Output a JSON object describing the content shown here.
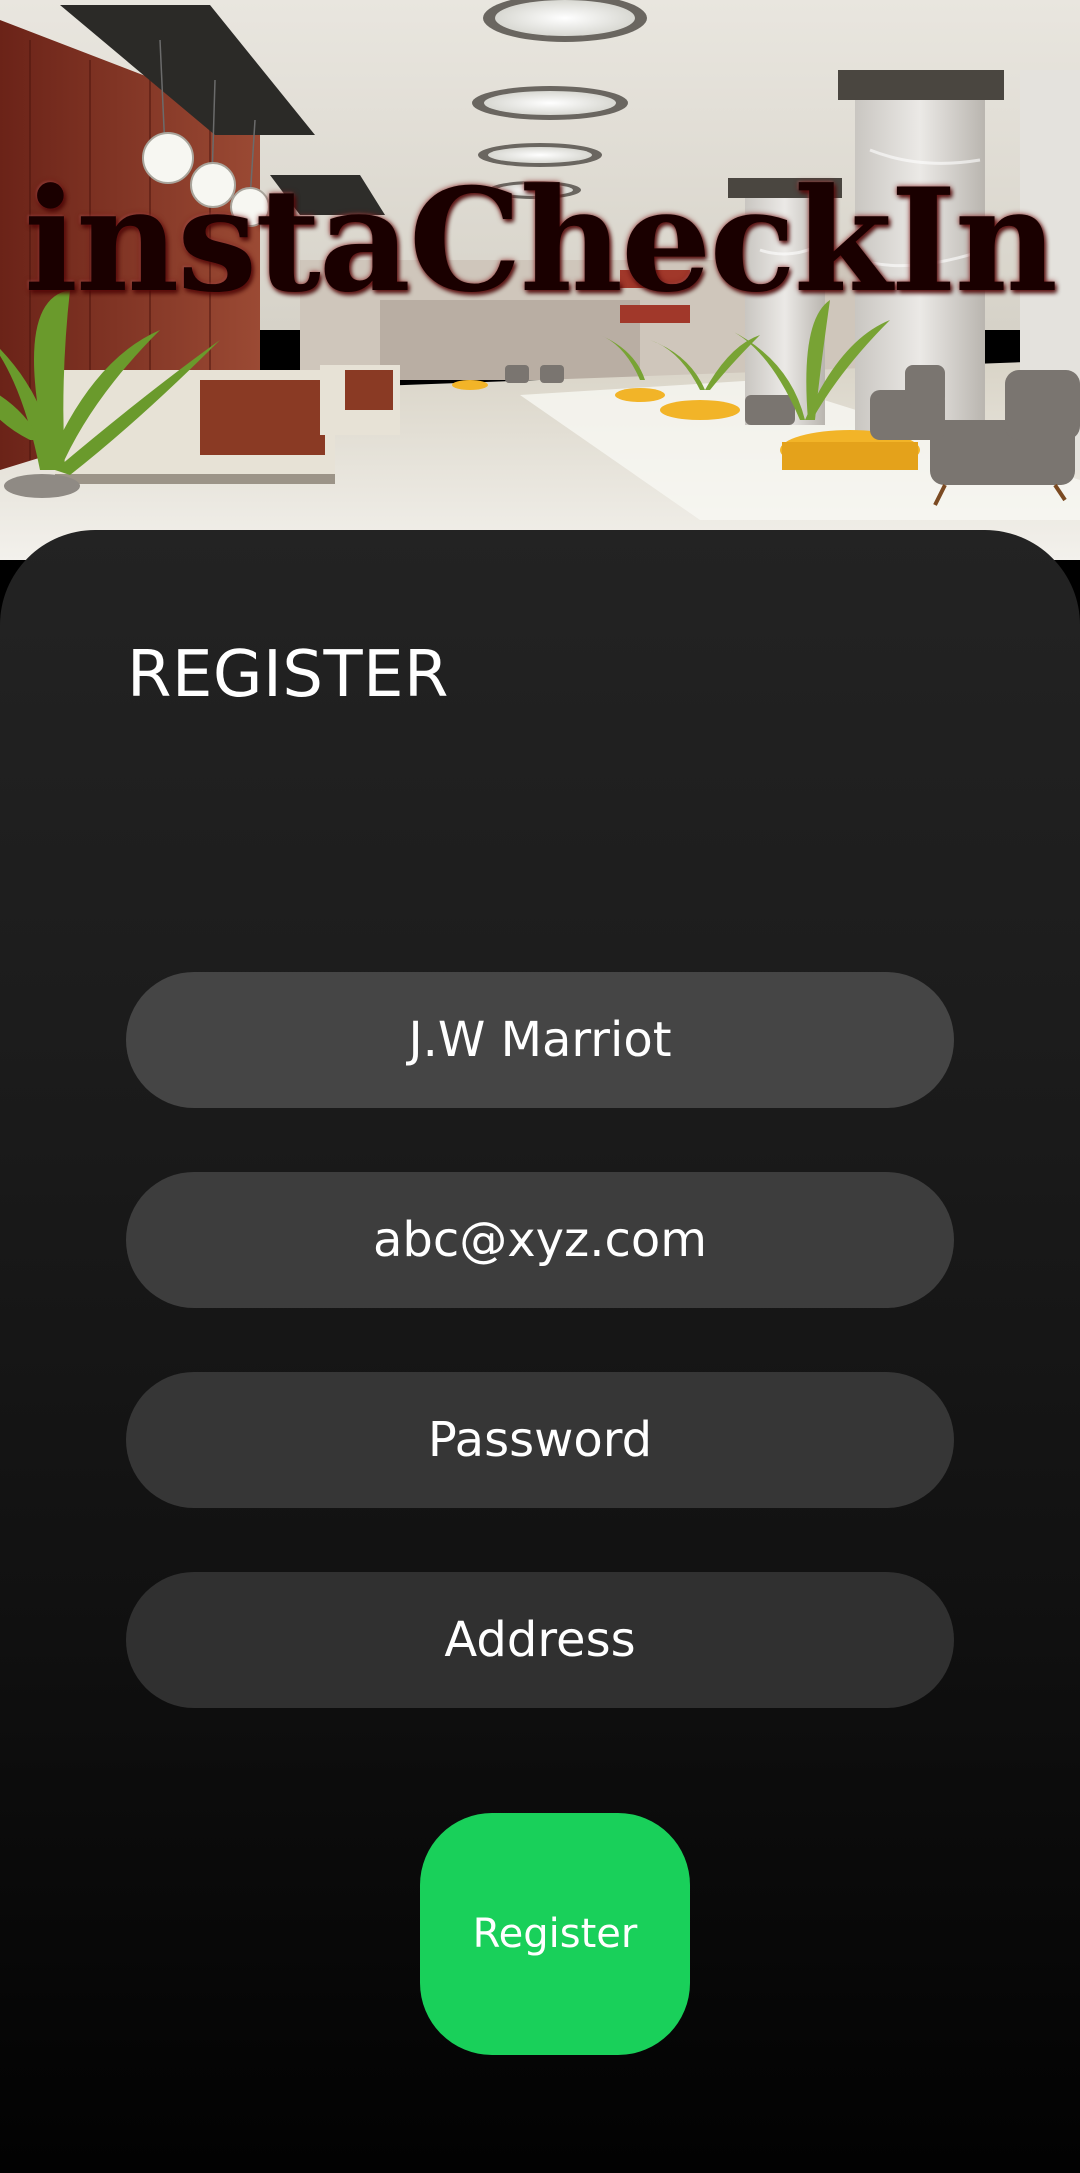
{
  "header": {
    "brand_title": "instaCheckIn"
  },
  "register_form": {
    "heading": "REGISTER",
    "hotel_name_value": "J.W Marriot",
    "email_value": "abc@xyz.com",
    "password_placeholder": "Password",
    "address_placeholder": "Address",
    "submit_label": "Register"
  },
  "colors": {
    "accent_button": "#19d05a",
    "card_background_top": "#232323",
    "card_background_bottom": "#020202",
    "field_background": "#424242",
    "text_primary": "#ffffff"
  },
  "icons": {
    "hero_image": "hotel-lobby-image"
  }
}
